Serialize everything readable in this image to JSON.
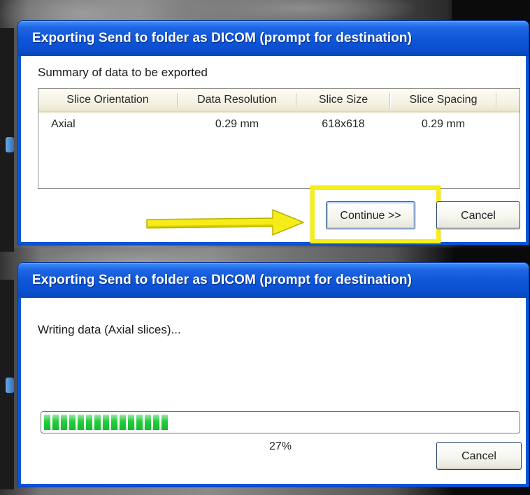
{
  "dialog1": {
    "title": "Exporting Send to folder as DICOM (prompt for destination)",
    "summary_label": "Summary of data to be exported",
    "table": {
      "columns": [
        "Slice Orientation",
        "Data Resolution",
        "Slice Size",
        "Slice Spacing"
      ],
      "rows": [
        [
          "Axial",
          "0.29 mm",
          "618x618",
          "0.29 mm"
        ]
      ]
    },
    "continue_label": "Continue >>",
    "cancel_label": "Cancel"
  },
  "dialog2": {
    "title": "Exporting Send to folder as DICOM (prompt for destination)",
    "status_text": "Writing data (Axial slices)...",
    "progress_percent": 27,
    "percent_label": "27%",
    "cancel_label": "Cancel"
  },
  "colors": {
    "titlebar": "#0f56d8",
    "highlight": "#f6ee1c",
    "arrow": "#f5ec1a",
    "progress": "#1fcf3a"
  }
}
